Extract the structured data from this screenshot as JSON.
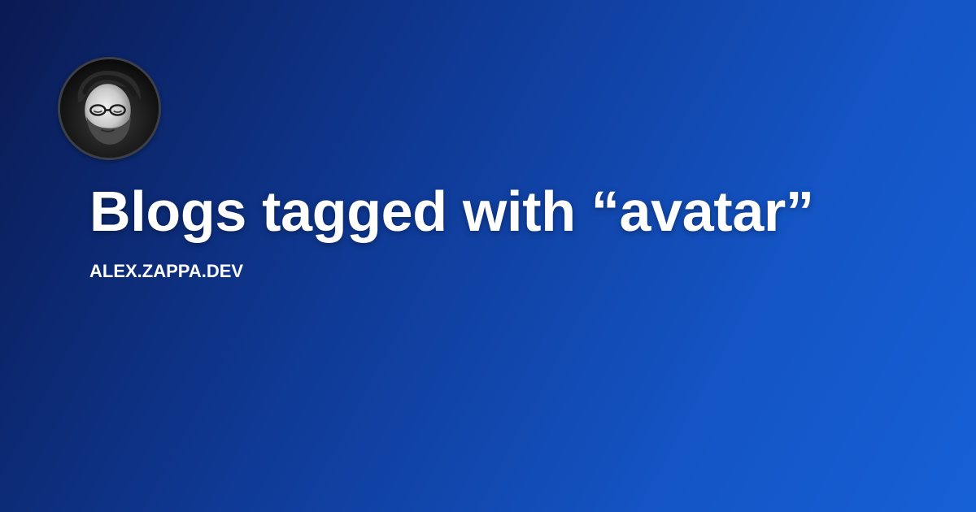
{
  "page": {
    "title": "Blogs tagged with “avatar”",
    "site": "ALEX.ZAPPA.DEV"
  },
  "avatar": {
    "icon": "person-photo-icon"
  },
  "colors": {
    "background_start": "#0a1a52",
    "background_end": "#1660d6",
    "text": "#ffffff"
  }
}
